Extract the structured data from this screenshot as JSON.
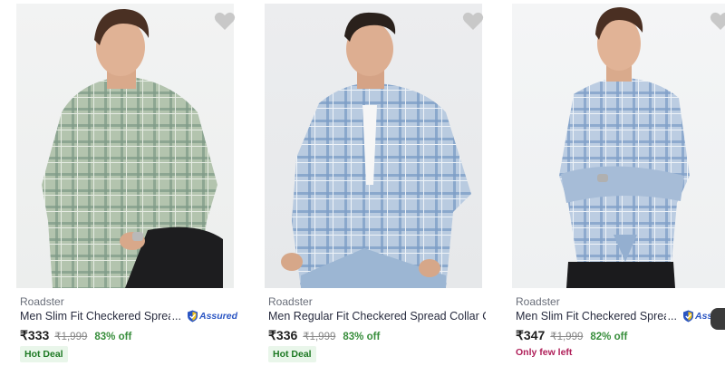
{
  "products": [
    {
      "brand": "Roadster",
      "name": "Men Slim Fit Checkered Spread",
      "ellipsis": "...",
      "assured": true,
      "assured_label": "Assured",
      "price": "₹333",
      "mrp": "₹1,999",
      "discount": "83% off",
      "tag": "Hot Deal",
      "tag_type": "deal",
      "wishlist_icon": "heart-icon",
      "shirt_color": "#9fb49a",
      "check_color": "#6f8d77"
    },
    {
      "brand": "Roadster",
      "name": "Men Regular Fit Checkered Spread Collar Ca...",
      "ellipsis": "",
      "assured": false,
      "assured_label": "",
      "price": "₹336",
      "mrp": "₹1,999",
      "discount": "83% off",
      "tag": "Hot Deal",
      "tag_type": "deal",
      "wishlist_icon": "heart-icon",
      "shirt_color": "#a9bfd6",
      "check_color": "#6a8fb8"
    },
    {
      "brand": "Roadster",
      "name": "Men Slim Fit Checkered Spread",
      "ellipsis": "...",
      "assured": true,
      "assured_label": "Assured",
      "price": "₹347",
      "mrp": "₹1,999",
      "discount": "82% off",
      "tag": "Only few left",
      "tag_type": "few",
      "wishlist_icon": "heart-icon",
      "shirt_color": "#adc3dc",
      "check_color": "#7396c1"
    }
  ],
  "colors": {
    "discount": "#388e3c",
    "hot_deal_bg": "#e9f6ea",
    "only_few_left": "#b0205a",
    "assured_blue": "#2a55c3"
  }
}
